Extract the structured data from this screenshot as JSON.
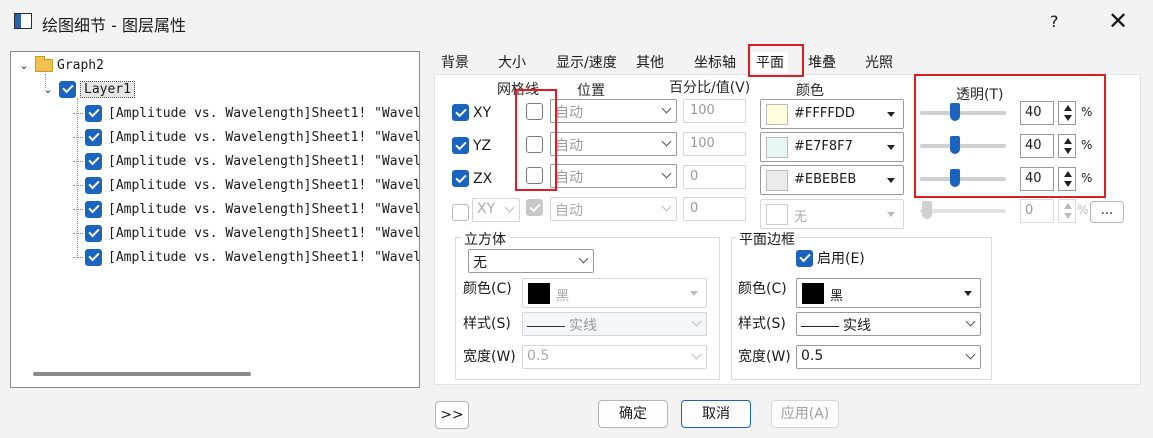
{
  "window": {
    "title": "绘图细节 - 图层属性",
    "help": "?",
    "close": "✕"
  },
  "tree": {
    "root": "Graph2",
    "layer": "Layer1",
    "plots": [
      "[Amplitude vs. Wavelength]Sheet1! \"Wavel",
      "[Amplitude vs. Wavelength]Sheet1! \"Wavel",
      "[Amplitude vs. Wavelength]Sheet1! \"Wavel",
      "[Amplitude vs. Wavelength]Sheet1! \"Wavel",
      "[Amplitude vs. Wavelength]Sheet1! \"Wavel",
      "[Amplitude vs. Wavelength]Sheet1! \"Wavel",
      "[Amplitude vs. Wavelength]Sheet1! \"Wavel"
    ]
  },
  "tabs": [
    "背景",
    "大小",
    "显示/速度",
    "其他",
    "坐标轴",
    "平面",
    "堆叠",
    "光照"
  ],
  "active_tab": "平面",
  "headers": {
    "grid": "网格线",
    "position": "位置",
    "percent": "百分比/值(V)",
    "color": "颜色",
    "transparency": "透明(T)"
  },
  "planes": [
    {
      "name": "XY",
      "checked": true,
      "grid": false,
      "position": "自动",
      "value": "100",
      "color_hex": "#FFFFDD",
      "color_label": "#FFFFDD",
      "transparency": "40",
      "unit": "%"
    },
    {
      "name": "YZ",
      "checked": true,
      "grid": false,
      "position": "自动",
      "value": "100",
      "color_hex": "#E7F8F7",
      "color_label": "#E7F8F7",
      "transparency": "40",
      "unit": "%"
    },
    {
      "name": "ZX",
      "checked": true,
      "grid": false,
      "position": "自动",
      "value": "0",
      "color_hex": "#EBEBEB",
      "color_label": "#EBEBEB",
      "transparency": "40",
      "unit": "%"
    }
  ],
  "extra_row": {
    "name": "XY",
    "position": "自动",
    "value": "0",
    "color_label": "无",
    "transparency": "0",
    "unit": "%",
    "more": "..."
  },
  "cube": {
    "title": "立方体",
    "type": "无",
    "color_label": "颜色(C)",
    "color": "黑",
    "style_label": "样式(S)",
    "style": "实线",
    "width_label": "宽度(W)",
    "width": "0.5"
  },
  "border": {
    "title": "平面边框",
    "enable_label": "启用(E)",
    "color_label": "颜色(C)",
    "color": "黑",
    "style_label": "样式(S)",
    "style": "实线",
    "width_label": "宽度(W)",
    "width": "0.5"
  },
  "footer": {
    "expand": ">>",
    "ok": "确定",
    "cancel": "取消",
    "apply": "应用(A)"
  }
}
